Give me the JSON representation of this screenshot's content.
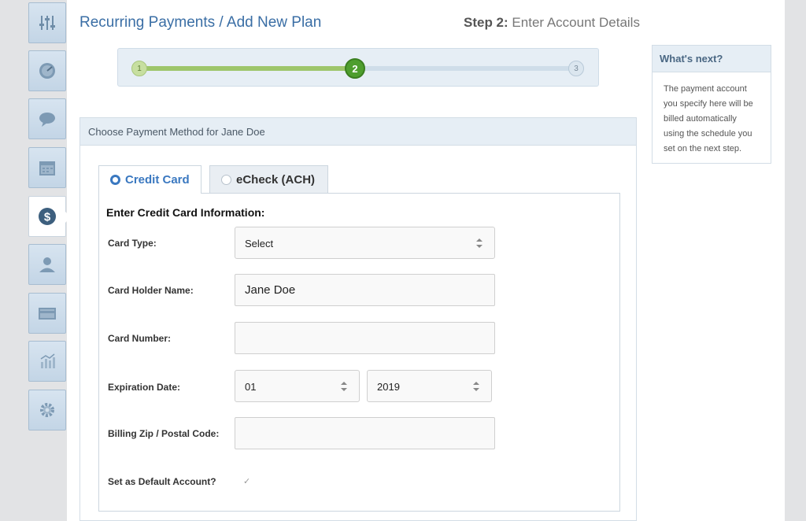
{
  "header": {
    "breadcrumb": "Recurring Payments / Add New Plan",
    "step_prefix": "Step 2:",
    "step_text": "Enter Account Details"
  },
  "progress": {
    "steps": [
      "1",
      "2",
      "3"
    ],
    "current_step": 2
  },
  "sidebar": {
    "items": [
      {
        "icon": "sliders-icon"
      },
      {
        "icon": "dashboard-icon"
      },
      {
        "icon": "chat-icon"
      },
      {
        "icon": "calendar-icon"
      },
      {
        "icon": "dollar-icon",
        "active": true
      },
      {
        "icon": "user-icon"
      },
      {
        "icon": "card-icon"
      },
      {
        "icon": "chart-icon"
      },
      {
        "icon": "gear-icon"
      }
    ]
  },
  "panel": {
    "title": "Choose Payment Method for Jane Doe",
    "tabs": [
      {
        "label": "Credit Card",
        "selected": true
      },
      {
        "label": "eCheck (ACH)",
        "selected": false
      }
    ],
    "section_title": "Enter Credit Card Information:",
    "fields": {
      "card_type": {
        "label": "Card Type:",
        "value": "Select"
      },
      "holder_name": {
        "label": "Card Holder Name:",
        "value": "Jane Doe"
      },
      "card_number": {
        "label": "Card Number:",
        "value": ""
      },
      "expiration": {
        "label": "Expiration Date:",
        "month": "01",
        "year": "2019"
      },
      "zip": {
        "label": "Billing Zip / Postal Code:",
        "value": ""
      },
      "default": {
        "label": "Set as Default Account?",
        "mark": "✓"
      }
    }
  },
  "info": {
    "title": "What's next?",
    "body": "The payment account you specify here will be billed automatically using the schedule you set on the next step."
  },
  "colors": {
    "accent": "#3a78c0",
    "progress_done": "#9ec66b",
    "progress_current": "#4e9e2e"
  }
}
